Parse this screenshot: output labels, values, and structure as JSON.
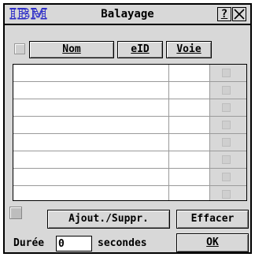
{
  "window": {
    "logo_text": "IBM",
    "title": "Balayage",
    "help_label": "?",
    "close_icon": "close-icon"
  },
  "columns": {
    "name": "Nom",
    "eid": "eID",
    "port": "Voie"
  },
  "list": {
    "rows": [
      {
        "name": "",
        "eid": "",
        "checked": false
      },
      {
        "name": "",
        "eid": "",
        "checked": false
      },
      {
        "name": "",
        "eid": "",
        "checked": false
      },
      {
        "name": "",
        "eid": "",
        "checked": false
      },
      {
        "name": "",
        "eid": "",
        "checked": false
      },
      {
        "name": "",
        "eid": "",
        "checked": false
      },
      {
        "name": "",
        "eid": "",
        "checked": false
      },
      {
        "name": "",
        "eid": "",
        "checked": false
      }
    ]
  },
  "buttons": {
    "add_remove": "Ajout./Suppr.",
    "clear": "Effacer",
    "ok": "OK"
  },
  "duration": {
    "label": "Durée",
    "value": "0",
    "unit": "secondes"
  },
  "colors": {
    "dialog_bg": "#d8d8d8",
    "logo": "#3030c8",
    "list_bg": "#ffffff"
  }
}
